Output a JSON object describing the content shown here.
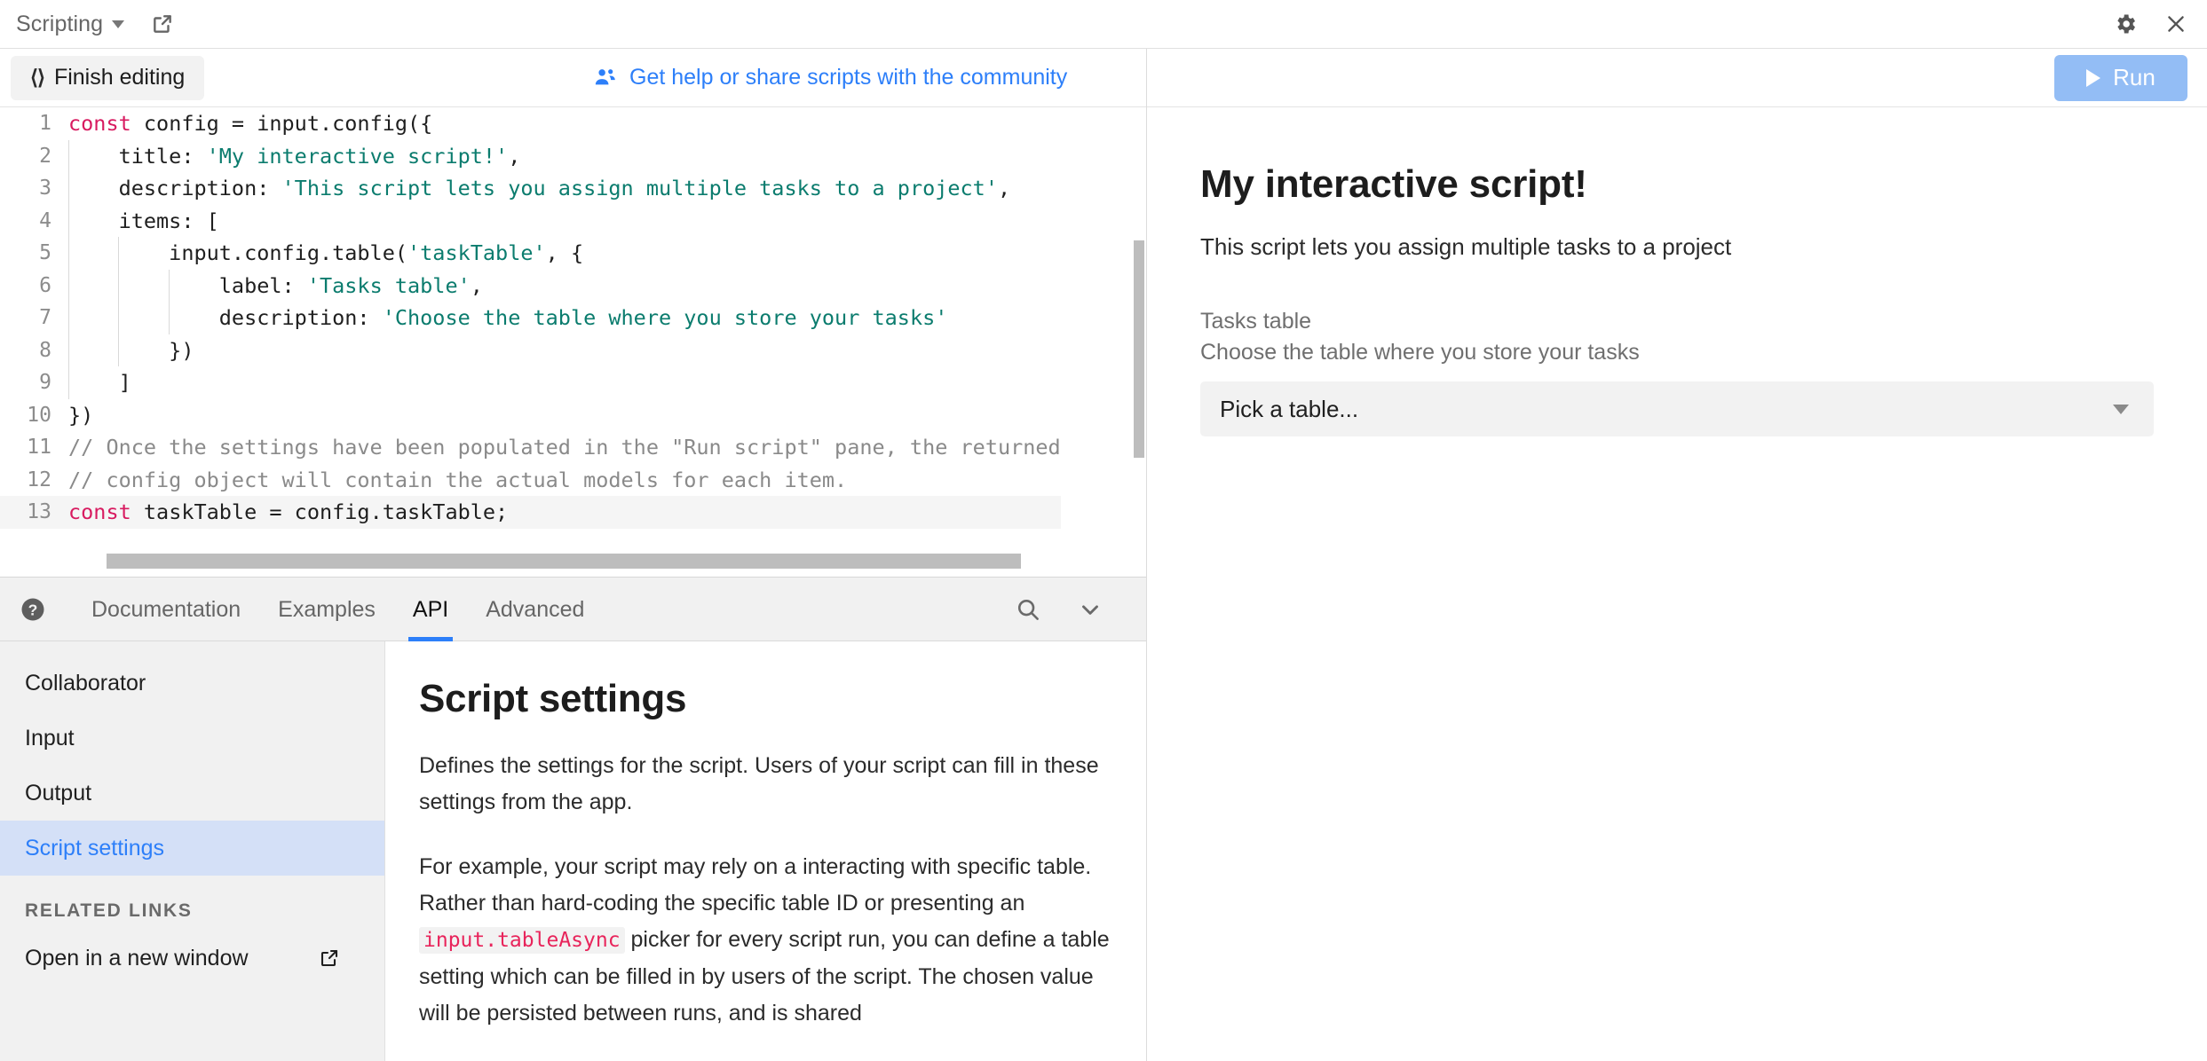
{
  "topbar": {
    "app_name": "Scripting",
    "dropdown_caret": "chevron-down",
    "popout_icon": "external-link-icon",
    "settings_icon": "gear-icon",
    "close_icon": "close-icon"
  },
  "editor_toolbar": {
    "finish_editing_label": "Finish editing",
    "code_icon": "‹›",
    "community_link_label": "Get help or share scripts with the community",
    "community_icon": "people-icon"
  },
  "editor": {
    "lines": [
      {
        "n": "1",
        "indent": 0,
        "tokens": [
          {
            "t": "kw",
            "v": "const"
          },
          {
            "t": "plain",
            "v": " config = input.config({"
          }
        ]
      },
      {
        "n": "2",
        "indent": 1,
        "tokens": [
          {
            "t": "plain",
            "v": "    title: "
          },
          {
            "t": "str",
            "v": "'My interactive script!'"
          },
          {
            "t": "plain",
            "v": ","
          }
        ]
      },
      {
        "n": "3",
        "indent": 1,
        "tokens": [
          {
            "t": "plain",
            "v": "    description: "
          },
          {
            "t": "str",
            "v": "'This script lets you assign multiple tasks to a project'"
          },
          {
            "t": "plain",
            "v": ","
          }
        ]
      },
      {
        "n": "4",
        "indent": 1,
        "tokens": [
          {
            "t": "plain",
            "v": "    items: ["
          }
        ]
      },
      {
        "n": "5",
        "indent": 2,
        "tokens": [
          {
            "t": "plain",
            "v": "        input.config.table("
          },
          {
            "t": "str",
            "v": "'taskTable'"
          },
          {
            "t": "plain",
            "v": ", {"
          }
        ]
      },
      {
        "n": "6",
        "indent": 3,
        "tokens": [
          {
            "t": "plain",
            "v": "            label: "
          },
          {
            "t": "str",
            "v": "'Tasks table'"
          },
          {
            "t": "plain",
            "v": ","
          }
        ]
      },
      {
        "n": "7",
        "indent": 3,
        "tokens": [
          {
            "t": "plain",
            "v": "            description: "
          },
          {
            "t": "str",
            "v": "'Choose the table where you store your tasks'"
          }
        ]
      },
      {
        "n": "8",
        "indent": 2,
        "tokens": [
          {
            "t": "plain",
            "v": "        })"
          }
        ]
      },
      {
        "n": "9",
        "indent": 1,
        "tokens": [
          {
            "t": "plain",
            "v": "    ]"
          }
        ]
      },
      {
        "n": "10",
        "indent": 0,
        "tokens": [
          {
            "t": "plain",
            "v": "})"
          }
        ]
      },
      {
        "n": "11",
        "indent": 0,
        "tokens": [
          {
            "t": "cmt",
            "v": "// Once the settings have been populated in the \"Run script\" pane, the returned"
          }
        ]
      },
      {
        "n": "12",
        "indent": 0,
        "tokens": [
          {
            "t": "cmt",
            "v": "// config object will contain the actual models for each item."
          }
        ]
      },
      {
        "n": "13",
        "indent": 0,
        "active": true,
        "tokens": [
          {
            "t": "kw",
            "v": "const"
          },
          {
            "t": "plain",
            "v": " taskTable = config.taskTable;"
          }
        ]
      }
    ]
  },
  "docs": {
    "help_icon": "help-circle-icon",
    "tabs": [
      {
        "label": "Documentation",
        "active": false
      },
      {
        "label": "Examples",
        "active": false
      },
      {
        "label": "API",
        "active": true
      },
      {
        "label": "Advanced",
        "active": false
      }
    ],
    "search_icon": "search-icon",
    "collapse_icon": "chevron-down-icon",
    "nav_items": [
      {
        "label": "Collaborator",
        "active": false
      },
      {
        "label": "Input",
        "active": false
      },
      {
        "label": "Output",
        "active": false
      },
      {
        "label": "Script settings",
        "active": true
      }
    ],
    "related_links_header": "RELATED LINKS",
    "related_links": [
      {
        "label": "Open in a new window",
        "icon": "external-link-icon"
      }
    ],
    "content": {
      "heading": "Script settings",
      "paragraph_1": "Defines the settings for the script. Users of your script can fill in these settings from the app.",
      "paragraph_2_part_1": "For example, your script may rely on a interacting with specific table. Rather than hard-coding the specific table ID or presenting an ",
      "paragraph_2_code": "input.tableAsync",
      "paragraph_2_part_2": " picker for every script run, you can define a table setting which can be filled in by users of the script. The chosen value will be persisted between runs, and is shared"
    }
  },
  "run_pane": {
    "run_button_label": "Run",
    "run_icon": "play-icon",
    "preview": {
      "title": "My interactive script!",
      "description": "This script lets you assign multiple tasks to a project",
      "field_label": "Tasks table",
      "field_description": "Choose the table where you store your tasks",
      "select_value": "Pick a table...",
      "select_caret_icon": "caret-down-icon"
    }
  },
  "colors": {
    "accent_blue": "#2d7ff9",
    "run_button": "#93bdf5",
    "active_nav_bg": "#d4e0f7",
    "string_green": "#0b7c6e",
    "keyword_pink": "#d81b60",
    "comment_gray": "#8a8a8a",
    "inline_code_pink": "#e8245b"
  }
}
